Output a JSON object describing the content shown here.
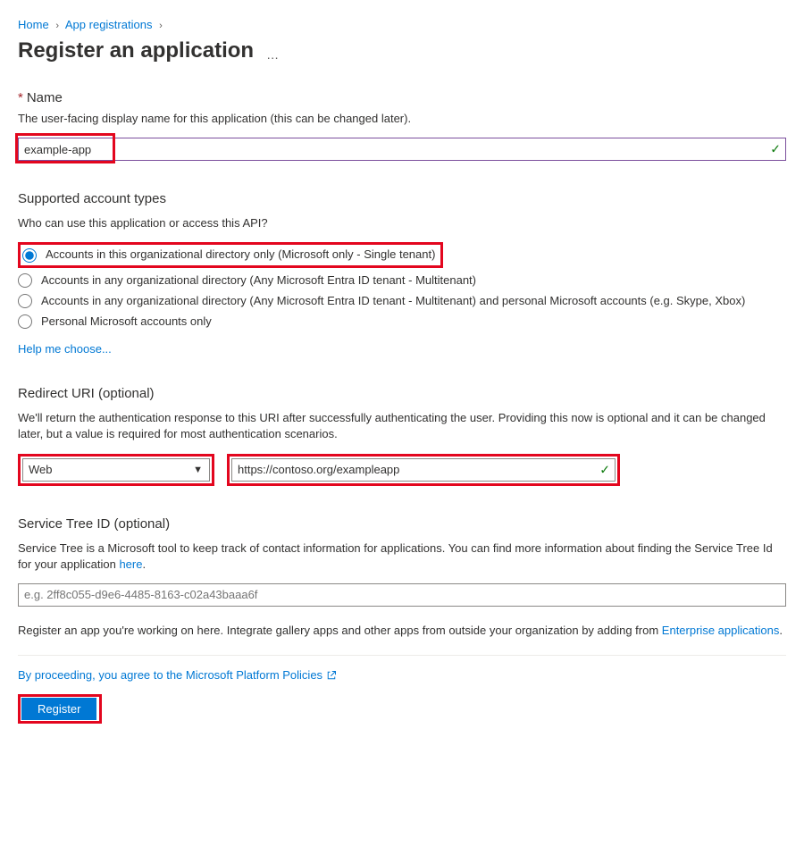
{
  "breadcrumb": {
    "home": "Home",
    "app_registrations": "App registrations"
  },
  "page_title": "Register an application",
  "name_section": {
    "label": "Name",
    "help": "The user-facing display name for this application (this can be changed later).",
    "value": "example-app"
  },
  "account_types": {
    "heading": "Supported account types",
    "question": "Who can use this application or access this API?",
    "options": [
      "Accounts in this organizational directory only (Microsoft only - Single tenant)",
      "Accounts in any organizational directory (Any Microsoft Entra ID tenant - Multitenant)",
      "Accounts in any organizational directory (Any Microsoft Entra ID tenant - Multitenant) and personal Microsoft accounts (e.g. Skype, Xbox)",
      "Personal Microsoft accounts only"
    ],
    "help_link": "Help me choose..."
  },
  "redirect_uri": {
    "heading": "Redirect URI (optional)",
    "help": "We'll return the authentication response to this URI after successfully authenticating the user. Providing this now is optional and it can be changed later, but a value is required for most authentication scenarios.",
    "platform": "Web",
    "uri_value": "https://contoso.org/exampleapp"
  },
  "service_tree": {
    "heading": "Service Tree ID (optional)",
    "help_before": "Service Tree is a Microsoft tool to keep track of contact information for applications. You can find more information about finding the Service Tree Id for your application ",
    "help_link": "here",
    "help_after": ".",
    "placeholder": "e.g. 2ff8c055-d9e6-4485-8163-c02a43baaa6f"
  },
  "gallery_note": {
    "before": "Register an app you're working on here. Integrate gallery apps and other apps from outside your organization by adding from ",
    "link": "Enterprise applications",
    "after": "."
  },
  "footer": {
    "policy_text": "By proceeding, you agree to the Microsoft Platform Policies",
    "register_label": "Register"
  }
}
